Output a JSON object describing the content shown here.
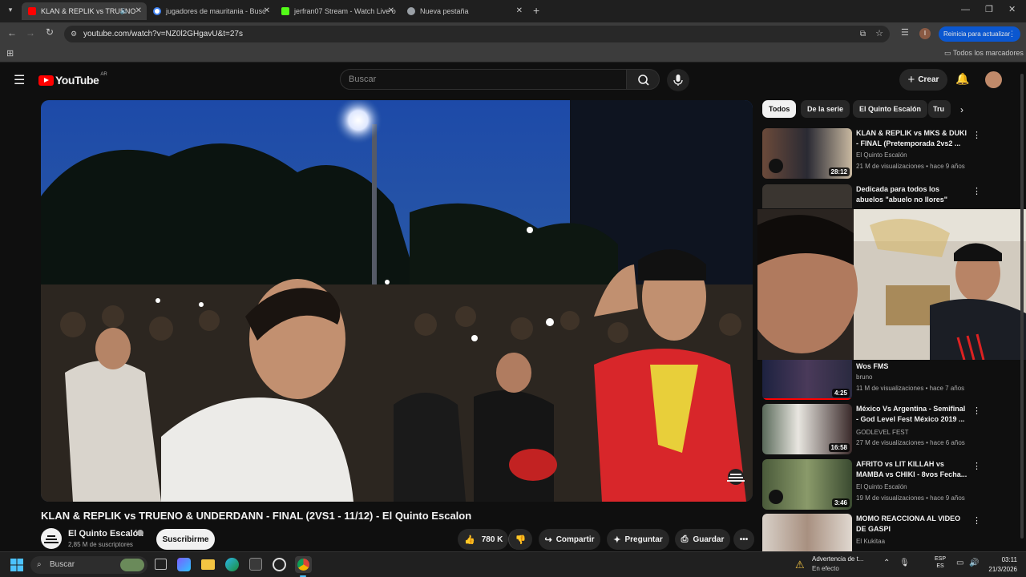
{
  "browser": {
    "tabs": [
      {
        "title": "KLAN & REPLIK vs TRUENO",
        "color": "#ff0000"
      },
      {
        "title": "jugadores de mauritania - Busc",
        "color": "#4285f4"
      },
      {
        "title": "jerfran07 Stream - Watch Live o",
        "color": "#53fc18"
      },
      {
        "title": "Nueva pestaña",
        "color": "#9aa0a6"
      }
    ],
    "url": "youtube.com/watch?v=NZ0l2GHgavU&t=27s",
    "profile_initial": "I",
    "update_label": "Reinicia para actualizar",
    "all_bookmarks": "Todos los marcadores"
  },
  "yt": {
    "logo": "YouTube",
    "region": "AR",
    "search_placeholder": "Buscar",
    "create_label": "Crear",
    "video_title": "KLAN & REPLIK vs TRUENO & UNDERDANN - FINAL (2VS1 - 11/12) - El Quinto Escalon",
    "channel_name": "El Quinto Escalón",
    "subscribers": "2,85 M de suscriptores",
    "subscribe_label": "Suscribirme",
    "likes": "780 K",
    "share_label": "Compartir",
    "ask_label": "Preguntar",
    "save_label": "Guardar",
    "chips": [
      "Todos",
      "De la serie",
      "El Quinto Escalón",
      "Tru"
    ],
    "recommendations": [
      {
        "title": "KLAN & REPLIK vs MKS & DUKI - FINAL (Pretemporada 2vs2 ...",
        "channel": "El Quinto Escalón",
        "meta": "21 M de visualizaciones • hace 9 años",
        "duration": "28:12"
      },
      {
        "title": "Dedicada para todos los abuelos \"abuelo no llores\"",
        "channel": "",
        "meta": "",
        "duration": ""
      },
      {
        "title": "Wos FMS",
        "channel": "bruno",
        "meta": "11 M de visualizaciones • hace 7 años",
        "duration": "4:25"
      },
      {
        "title": "México Vs Argentina - Semifinal - God Level Fest México 2019 ...",
        "channel": "GODLEVEL FEST",
        "meta": "27 M de visualizaciones • hace 6 años",
        "duration": "16:58"
      },
      {
        "title": "AFRITO vs LIT KILLAH vs MAMBA vs CHIKI - 8vos Fecha...",
        "channel": "El Quinto Escalón",
        "meta": "19 M de visualizaciones • hace 9 años",
        "duration": "3:46"
      },
      {
        "title": "MOMO REACCIONA AL VIDEO DE GASPI",
        "channel": "El Kukitaa",
        "meta": "",
        "duration": ""
      }
    ]
  },
  "taskbar": {
    "search_label": "Buscar",
    "notice_title": "Advertencia de t...",
    "notice_sub": "En efecto",
    "lang": "ESP",
    "lang_sub": "ES",
    "time": "03:11",
    "date": "21/3/2026"
  }
}
